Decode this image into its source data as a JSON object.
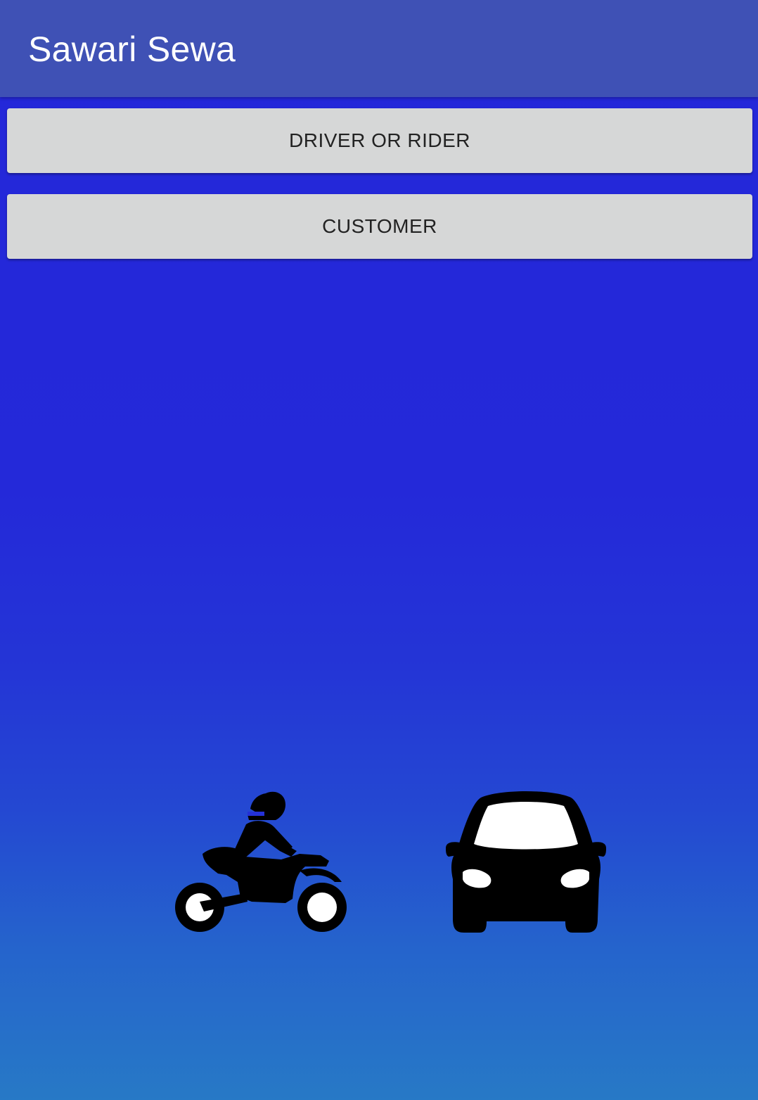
{
  "app_bar": {
    "title": "Sawari Sewa",
    "color": "#3f51b5"
  },
  "buttons": {
    "driver_label": "DRIVER OR RIDER",
    "customer_label": "CUSTOMER"
  },
  "background": {
    "top_color": "#2427d9",
    "bottom_color": "#2779c6"
  },
  "illustration": {
    "icons": [
      "motorcycle-rider-icon",
      "car-icon"
    ]
  }
}
